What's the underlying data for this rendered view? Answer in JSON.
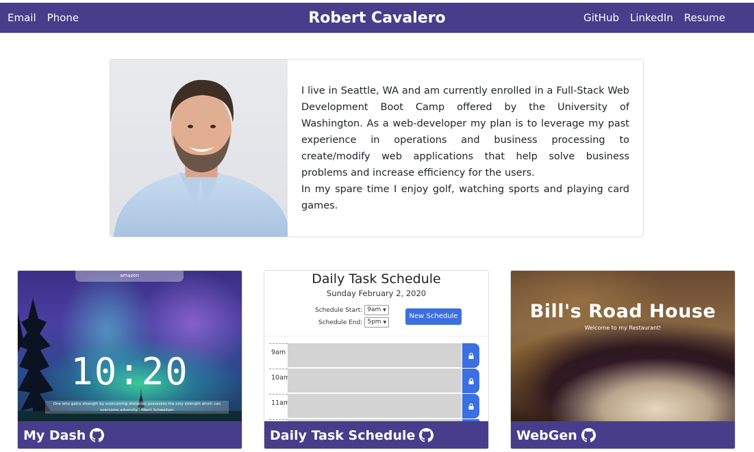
{
  "nav": {
    "left_links": [
      "Email",
      "Phone"
    ],
    "brand": "Robert Cavalero",
    "right_links": [
      "GitHub",
      "LinkedIn",
      "Resume"
    ]
  },
  "bio": {
    "paragraph1": "I live in Seattle, WA and am currently enrolled in a Full-Stack Web Development Boot Camp offered by the University of Washington. As a web-developer my plan is to leverage my past experience in operations and business processing to create/modify web applications that help solve business problems and increase efficiency for the users.",
    "paragraph2": "In my spare time I enjoy golf, watching sports and playing card games."
  },
  "projects": [
    {
      "title": "My Dash",
      "icon": "github-icon",
      "preview": {
        "search_text": "amazon",
        "clock": "10:20",
        "quote": "One who gains strength by overcoming obstacles possesses the only strength which can overcome adversity. -Albert Schweitzer"
      }
    },
    {
      "title": "Daily Task Schedule",
      "icon": "github-icon",
      "preview": {
        "heading": "Daily Task Schedule",
        "date": "Sunday February 2, 2020",
        "start_label": "Schedule Start:",
        "start_value": "9am",
        "end_label": "Schedule End:",
        "end_value": "5pm",
        "button": "New Schedule",
        "hours": [
          "9am",
          "10am",
          "11am"
        ]
      }
    },
    {
      "title": "WebGen",
      "icon": "github-icon",
      "preview": {
        "heading": "Bill's Road House",
        "subheading": "Welcome to my Restaurant!"
      }
    }
  ],
  "colors": {
    "brand": "#483d8b",
    "accent_blue": "#3c6fe0"
  }
}
